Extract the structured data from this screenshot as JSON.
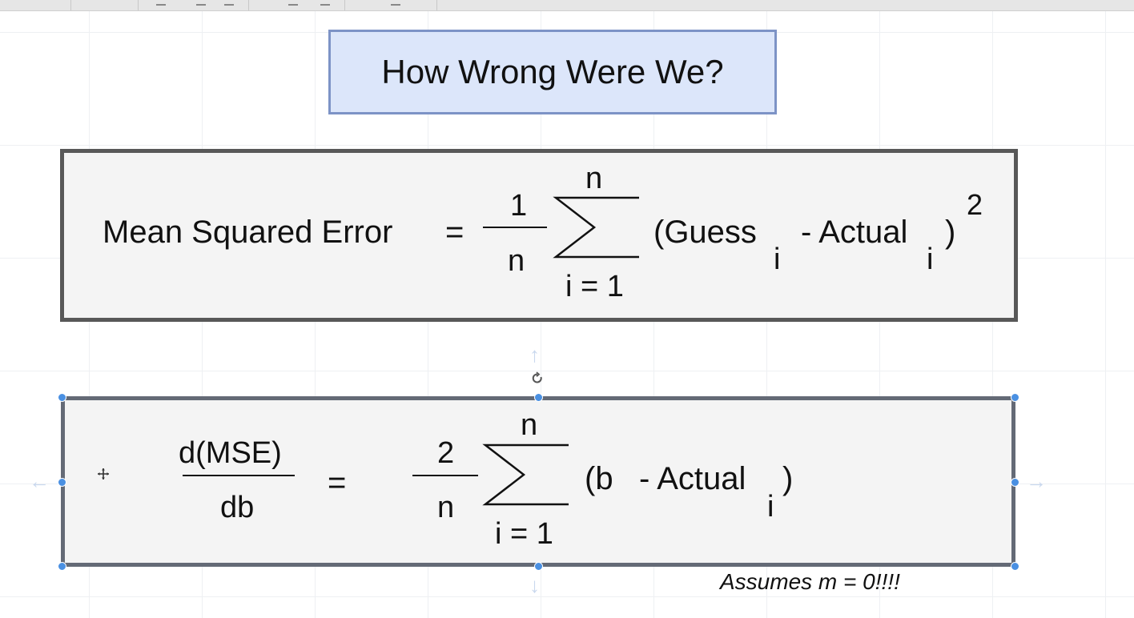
{
  "title": "How Wrong Were We?",
  "mse_formula": {
    "label": "Mean Squared Error",
    "equals": "=",
    "coef_numerator": "1",
    "coef_denominator": "n",
    "sum_upper": "n",
    "sum_lower": "i = 1",
    "term_open": "(Guess",
    "sub1": "i",
    "term_minus": "- Actual",
    "sub2": "i",
    "term_close": ")",
    "exponent": "2"
  },
  "derivative_formula": {
    "lhs_numerator": "d(MSE)",
    "lhs_denominator": "db",
    "equals": "=",
    "coef_numerator": "2",
    "coef_denominator": "n",
    "sum_upper": "n",
    "sum_lower": "i = 1",
    "term_open": "(b",
    "term_minus": "- Actual",
    "sub": "i",
    "term_close": ")"
  },
  "note": "Assumes m = 0!!!!",
  "icons": {
    "sigma": "summation-sign",
    "move": "move-cursor-icon",
    "rotate": "rotate-handle-icon"
  },
  "colors": {
    "title_fill": "#dce6fa",
    "title_border": "#7d93c6",
    "box_fill": "#f4f4f4",
    "box_border": "#585858",
    "selection_handle": "#4a90e2"
  }
}
